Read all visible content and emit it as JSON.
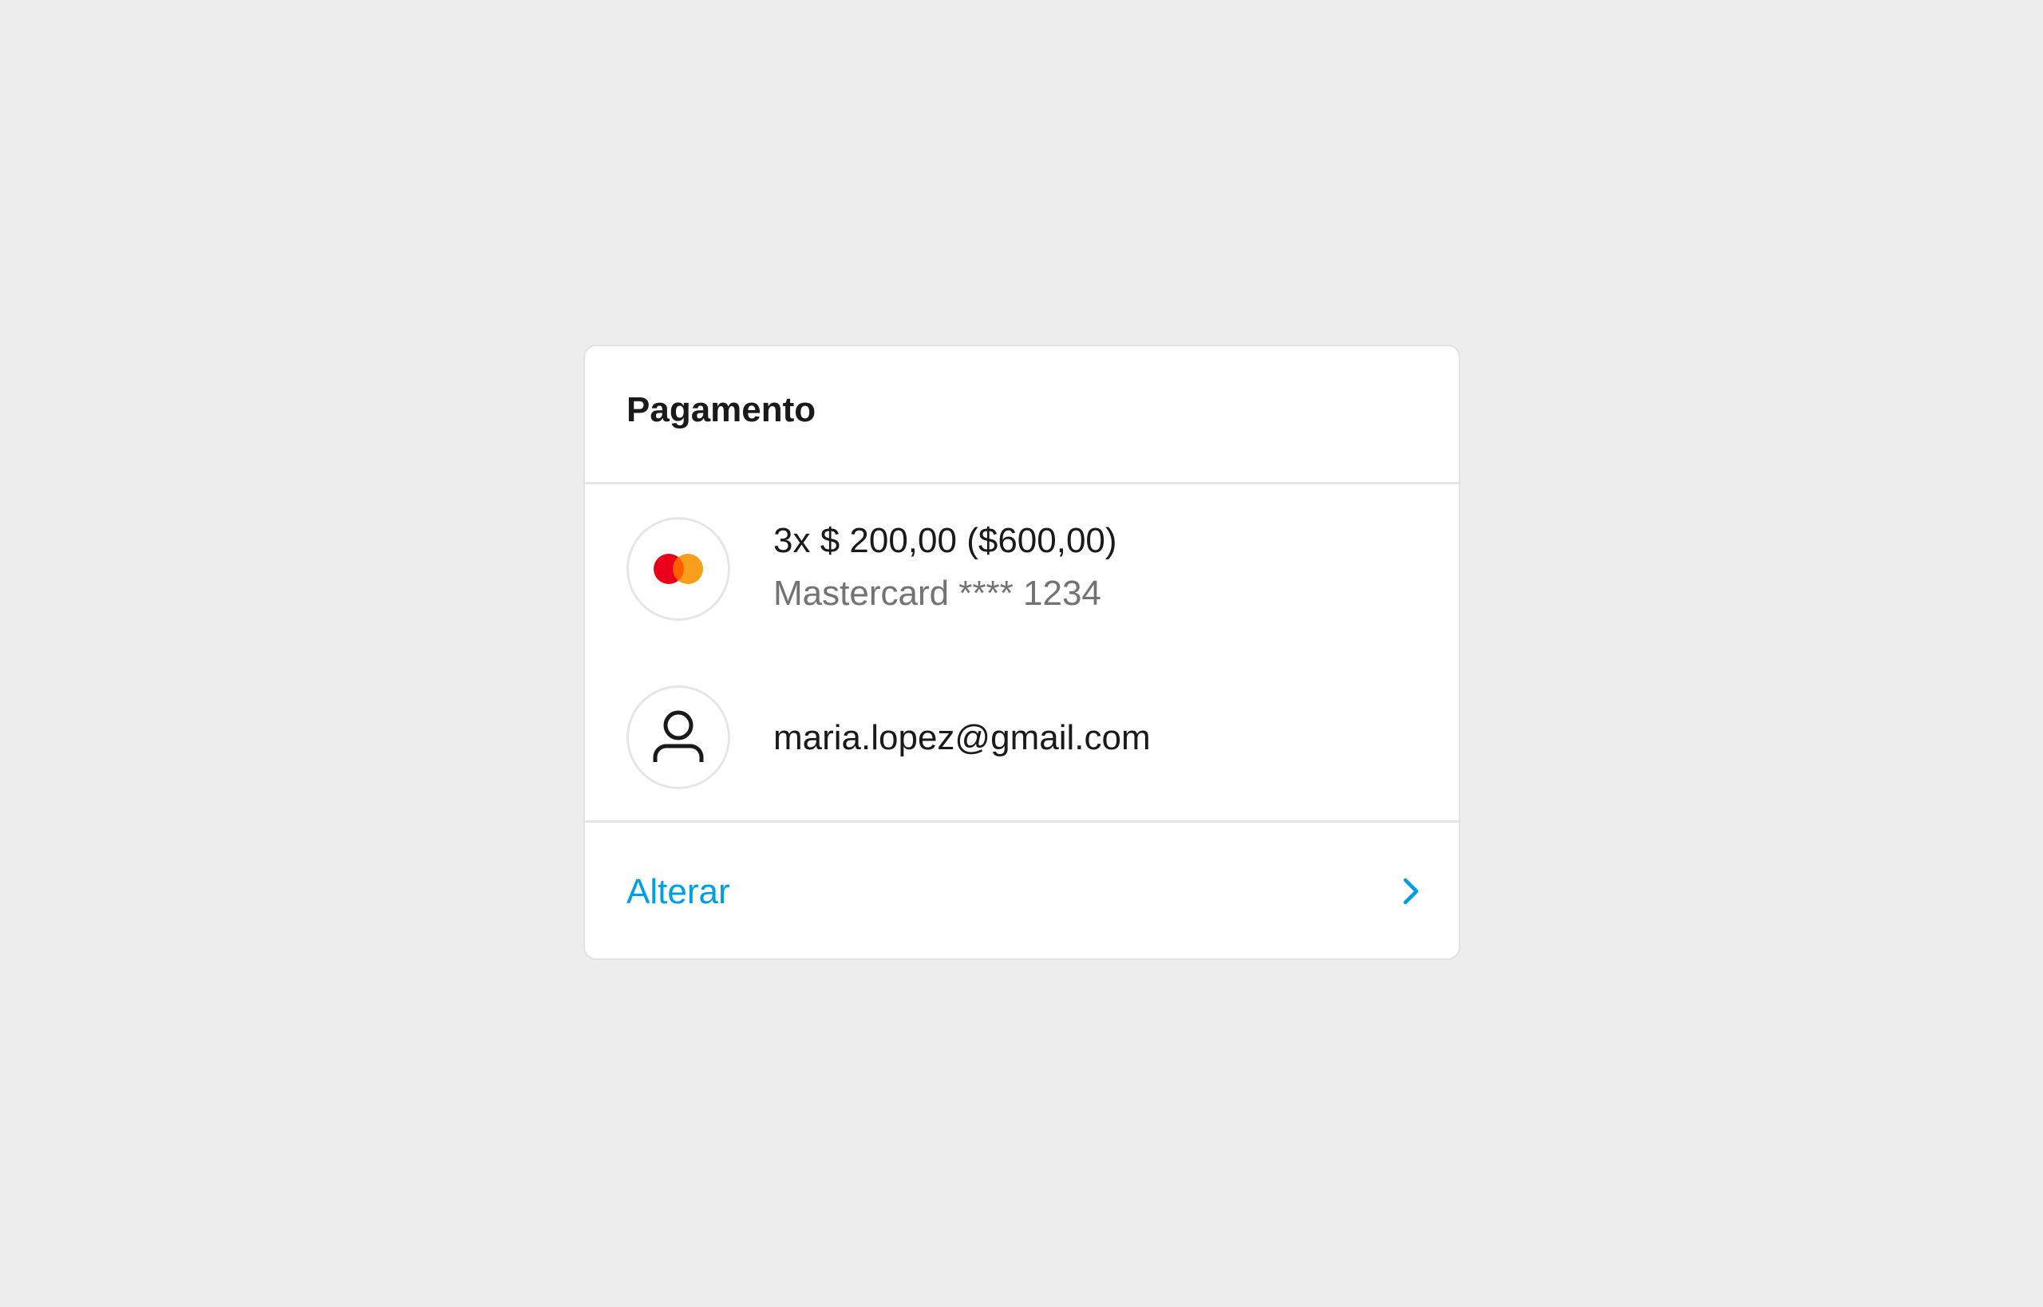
{
  "card": {
    "title": "Pagamento"
  },
  "payment": {
    "amount": "3x $ 200,00 ($600,00)",
    "card_info": "Mastercard **** 1234",
    "icon": "mastercard-icon"
  },
  "account": {
    "email": "maria.lopez@gmail.com",
    "icon": "user-icon"
  },
  "footer": {
    "change_label": "Alterar",
    "icon": "chevron-right-icon"
  },
  "colors": {
    "background": "#ededed",
    "card": "#ffffff",
    "link": "#009ee3",
    "mastercard_red": "#eb001b",
    "mastercard_orange": "#f79e1b"
  }
}
